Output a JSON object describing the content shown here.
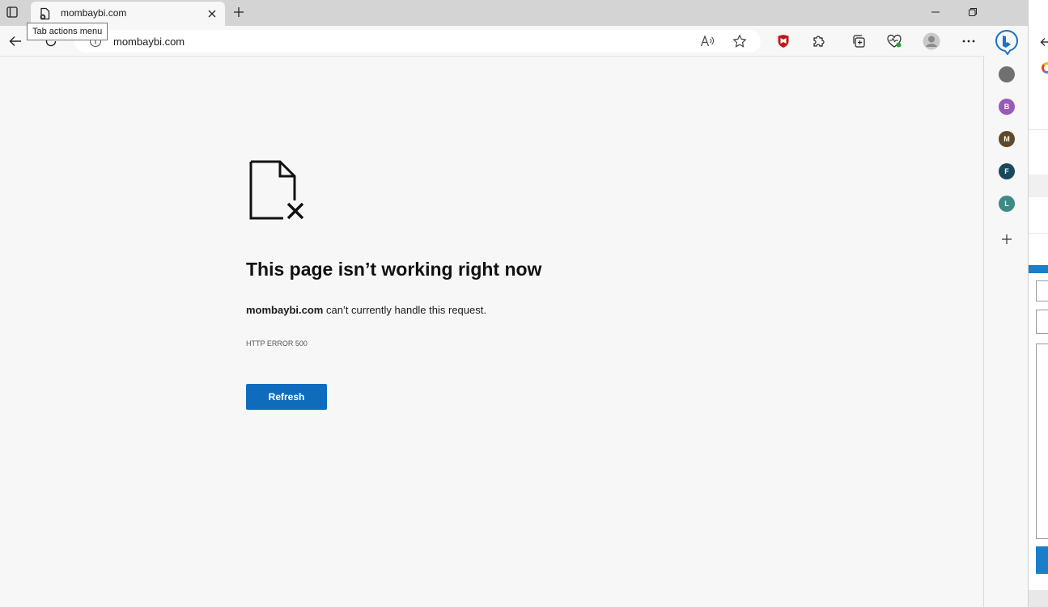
{
  "tab": {
    "title": "mombaybi.com",
    "tooltip": "Tab actions menu"
  },
  "address": {
    "url": "mombaybi.com"
  },
  "error": {
    "title": "This page isn’t working right now",
    "domain": "mombaybi.com",
    "message": " can’t currently handle this request.",
    "code": "HTTP ERROR 500",
    "refresh_label": "Refresh"
  },
  "sidebar": {
    "items": [
      {
        "letter": "",
        "color": "#707070"
      },
      {
        "letter": "B",
        "color": "#9b59b6"
      },
      {
        "letter": "M",
        "color": "#5c4a28"
      },
      {
        "letter": "F",
        "color": "#174a5c"
      },
      {
        "letter": "L",
        "color": "#3e8a85"
      }
    ]
  },
  "colors": {
    "accent": "#0f6cbd",
    "mcafee": "#c01818"
  }
}
